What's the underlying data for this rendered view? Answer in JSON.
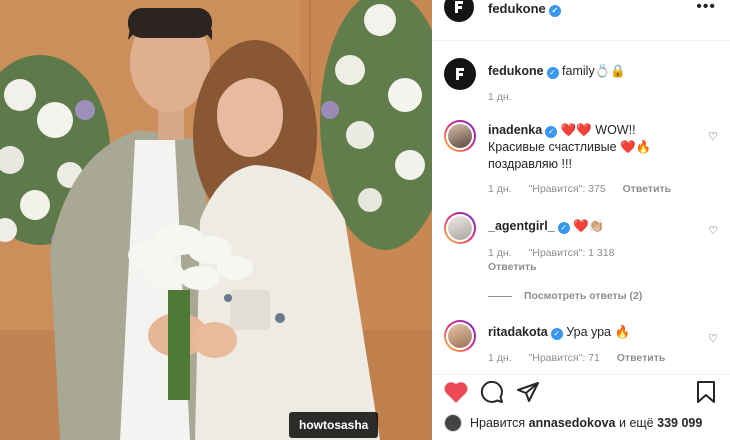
{
  "photo": {
    "tag_label": "howtosasha"
  },
  "post": {
    "username": "fedukone",
    "more_label": "•••",
    "caption_text": "family💍🔒",
    "caption_time": "1 дн."
  },
  "comments": [
    {
      "username": "inadenka",
      "line1": "❤️❤️ WOW!!",
      "line2": "Красивые счастливые ❤️🔥",
      "line3": "поздравляю !!!",
      "time": "1 дн.",
      "likes": "\"Нравится\": 375",
      "reply": "Ответить"
    },
    {
      "username": "_agentgirl_",
      "line1": "❤️👏🏼",
      "time": "1 дн.",
      "likes": "\"Нравится\": 1 318",
      "reply": "Ответить",
      "view_replies": "Посмотреть ответы (2)"
    },
    {
      "username": "ritadakota",
      "line1": "Ура ура 🔥",
      "time": "1 дн.",
      "likes": "\"Нравится\": 71",
      "reply": "Ответить"
    }
  ],
  "likes_line": {
    "prefix": "Нравится",
    "user": "annasedokova",
    "middle": "и ещё",
    "count": "339 099"
  },
  "icons": [
    "verified-icon",
    "more-icon",
    "heart-icon",
    "comment-icon",
    "share-icon",
    "bookmark-icon"
  ],
  "colors": {
    "verified": "#3897f0",
    "like_red": "#ed4956",
    "muted": "#8e8e8e"
  }
}
